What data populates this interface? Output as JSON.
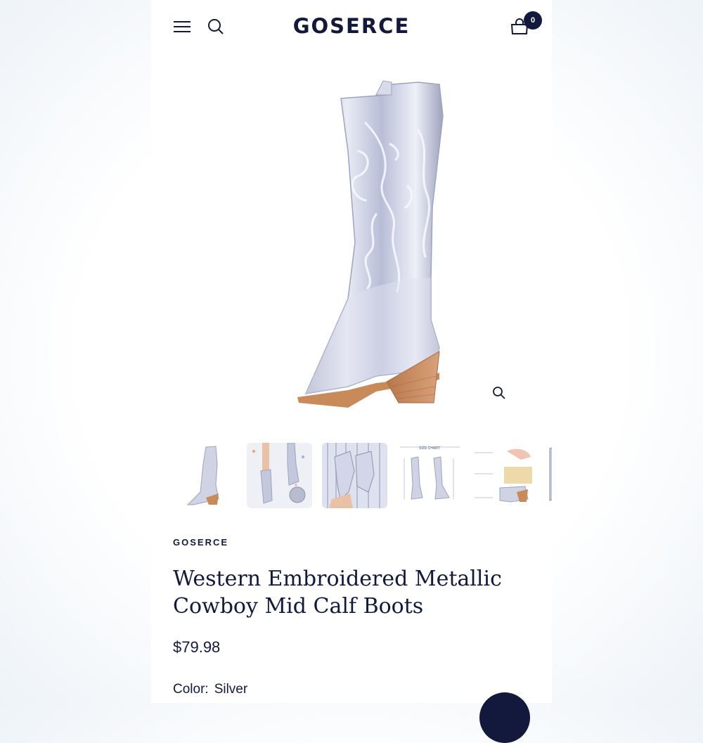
{
  "header": {
    "logo": "GOSERCE",
    "cart_count": "0",
    "icons": [
      "menu-icon",
      "search-icon",
      "cart-icon"
    ]
  },
  "gallery": {
    "main_image": "silver metallic western cowboy boot with white embroidery",
    "zoom_icon": "zoom-icon",
    "thumbnails": [
      {
        "name": "thumb-boot-side"
      },
      {
        "name": "thumb-lifestyle-disco-ball"
      },
      {
        "name": "thumb-lifestyle-tinsel"
      },
      {
        "name": "thumb-size-chart",
        "label": "SIZE CHART"
      },
      {
        "name": "thumb-features"
      },
      {
        "name": "thumb-partial"
      }
    ]
  },
  "product": {
    "vendor": "GOSERCE",
    "title": "Western Embroidered Metallic Cowboy Mid Calf Boots",
    "price": "$79.98",
    "color_label": "Color:",
    "color_value": "Silver"
  },
  "colors": {
    "navy": "#13193c",
    "silver": "#c9cde0",
    "heel": "#c98a5a"
  }
}
